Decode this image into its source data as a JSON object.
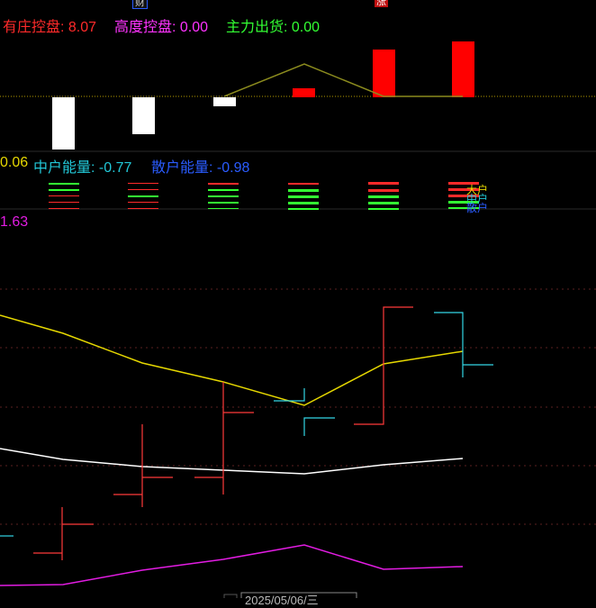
{
  "top_markers": {
    "left": "财",
    "right": "涨"
  },
  "panel1": {
    "items": [
      {
        "label": "有庄控盘:",
        "value": "8.07",
        "color": "#ff2a2a"
      },
      {
        "label": "高度控盘:",
        "value": "0.00",
        "color": "#ff33ff"
      },
      {
        "label": "主力出货:",
        "value": "0.00",
        "color": "#33ff33"
      }
    ]
  },
  "panel2": {
    "partial_value": "0.06",
    "items": [
      {
        "label": "中户能量:",
        "value": "-0.77",
        "color": "#22c8d8"
      },
      {
        "label": "散户能量:",
        "value": "-0.98",
        "color": "#2a5cff"
      }
    ],
    "legend": [
      "大户",
      "中户",
      "散户"
    ]
  },
  "panel3": {
    "partial_value": "1.63"
  },
  "bottom_date": "2025/05/06/三",
  "colors": {
    "up": "#ff0000",
    "down": "#ffffff",
    "yellow": "#e6d800",
    "cyan": "#33d7e6",
    "magenta": "#e21ce2",
    "white": "#ffffff",
    "olive": "#8c8c1e",
    "grid": "#5a2020"
  }
}
